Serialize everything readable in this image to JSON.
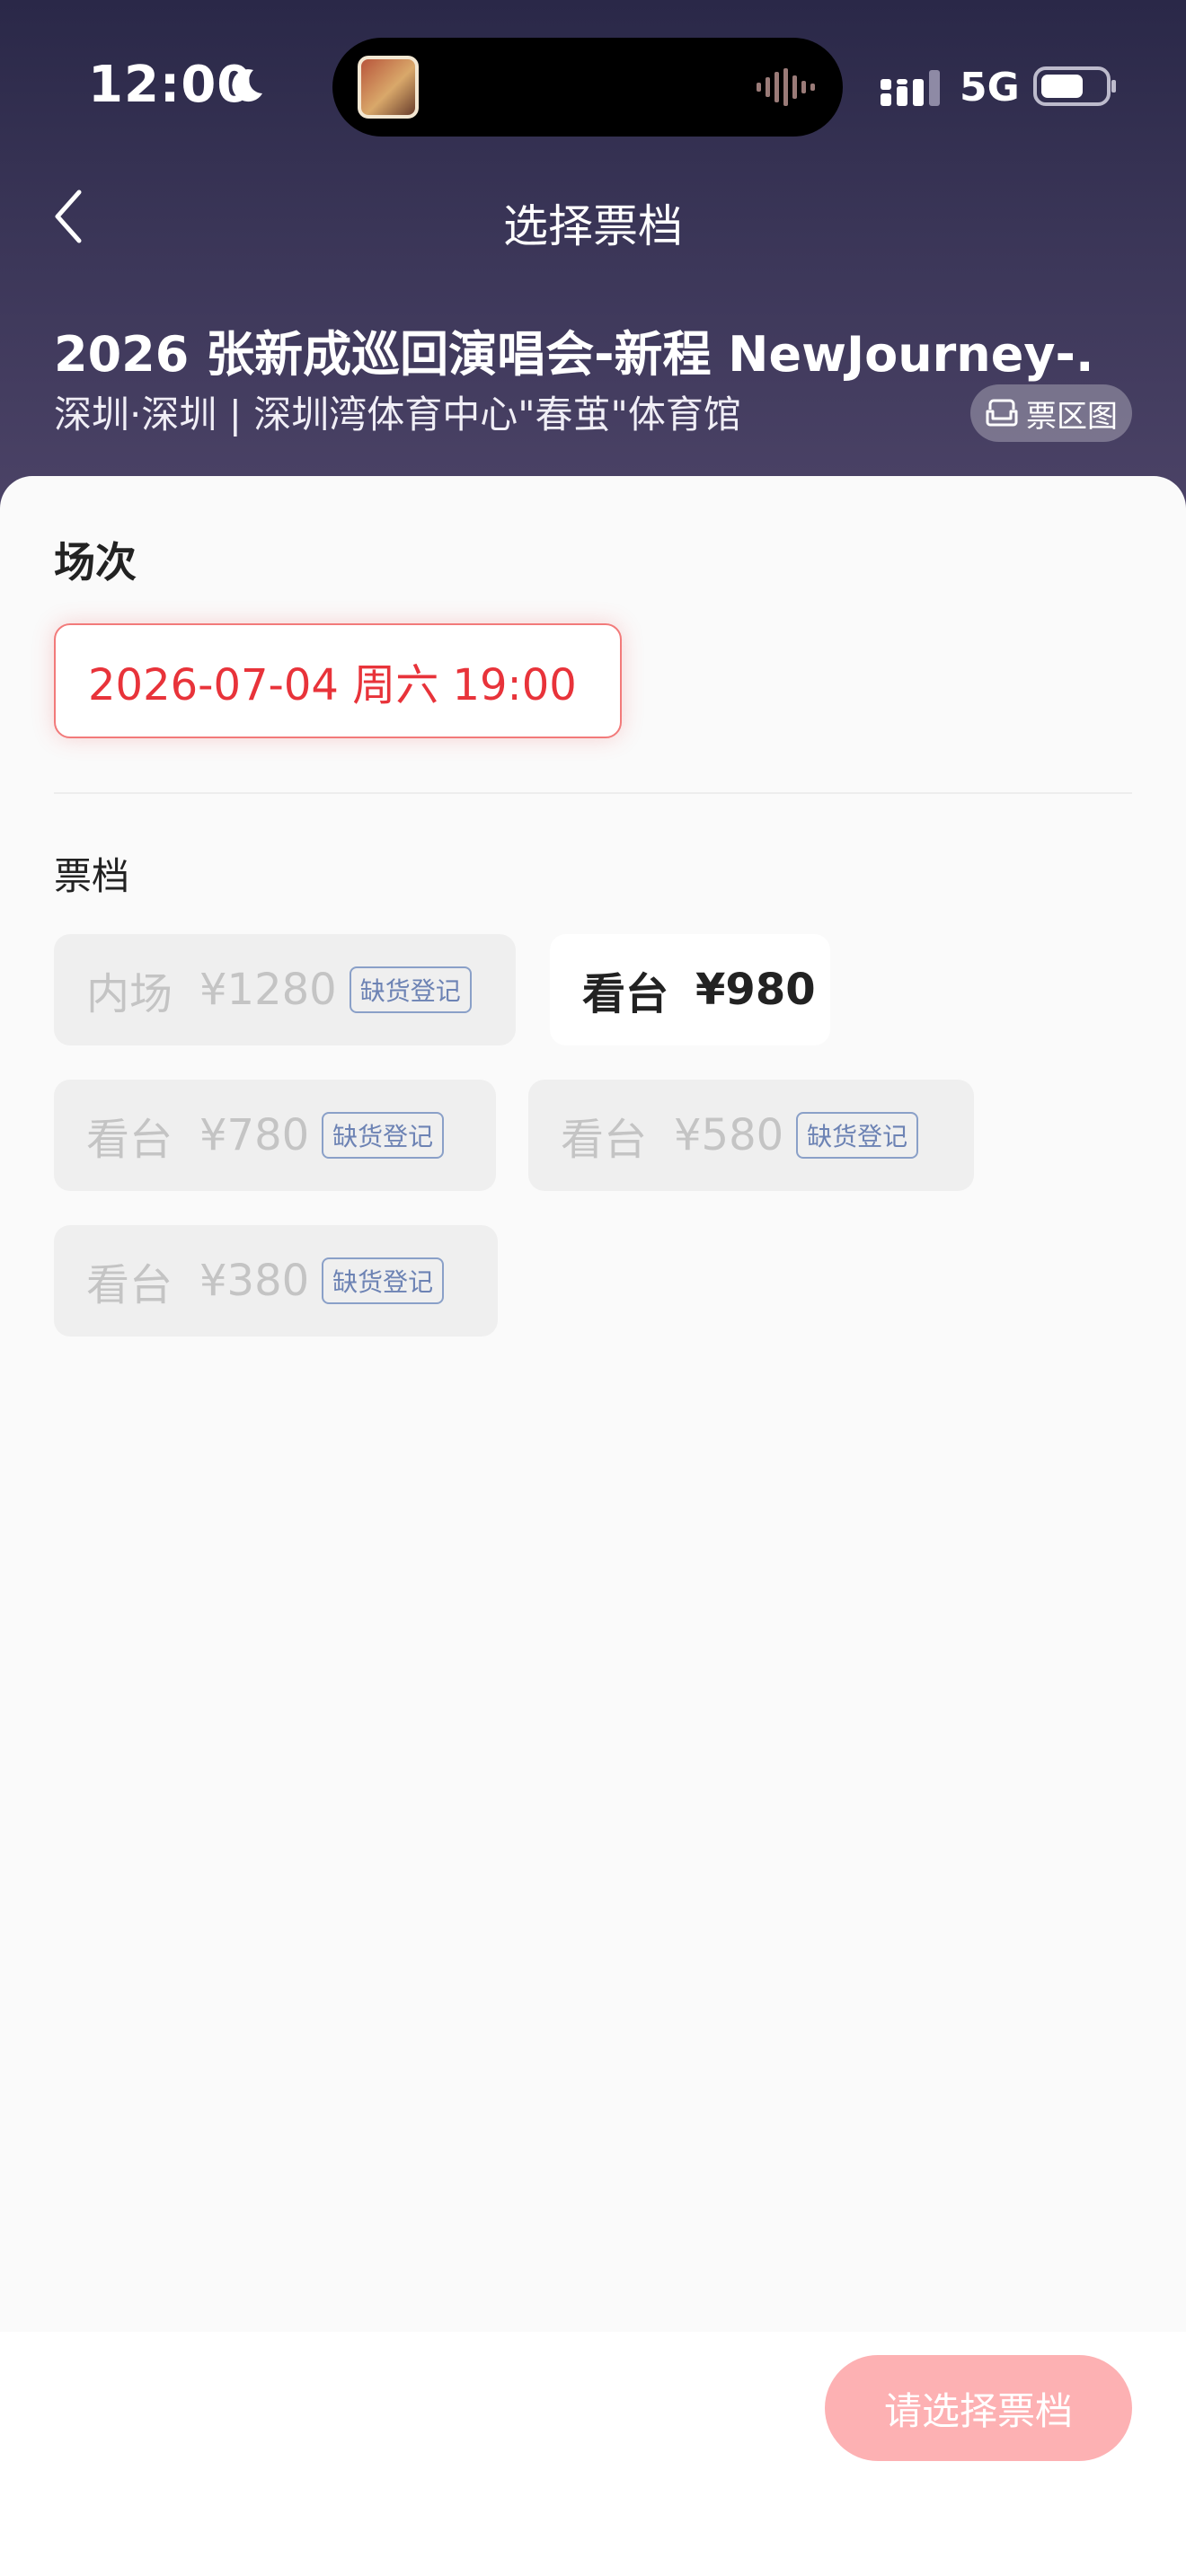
{
  "status_bar": {
    "time": "12:00",
    "network": "5G"
  },
  "nav": {
    "title": "选择票档"
  },
  "event": {
    "title": "2026 张新成巡回演唱会-新程 NewJourney-...",
    "venue": "深圳·深圳 | 深圳湾体育中心\"春茧\"体育馆",
    "map_label": "票区图"
  },
  "session": {
    "heading": "场次",
    "selected": "2026-07-04 周六 19:00"
  },
  "tiers": {
    "heading": "票档",
    "items": [
      {
        "name": "内场",
        "price": "¥1280",
        "badge": "缺货登记",
        "available": false
      },
      {
        "name": "看台",
        "price": "¥980",
        "badge": "",
        "available": true
      },
      {
        "name": "看台",
        "price": "¥780",
        "badge": "缺货登记",
        "available": false
      },
      {
        "name": "看台",
        "price": "¥580",
        "badge": "缺货登记",
        "available": false
      },
      {
        "name": "看台",
        "price": "¥380",
        "badge": "缺货登记",
        "available": false
      }
    ]
  },
  "footer": {
    "button_label": "请选择票档"
  },
  "colors": {
    "accent": "#e8333a",
    "button_disabled": "#fdb1b3",
    "header": "#2a2848"
  }
}
